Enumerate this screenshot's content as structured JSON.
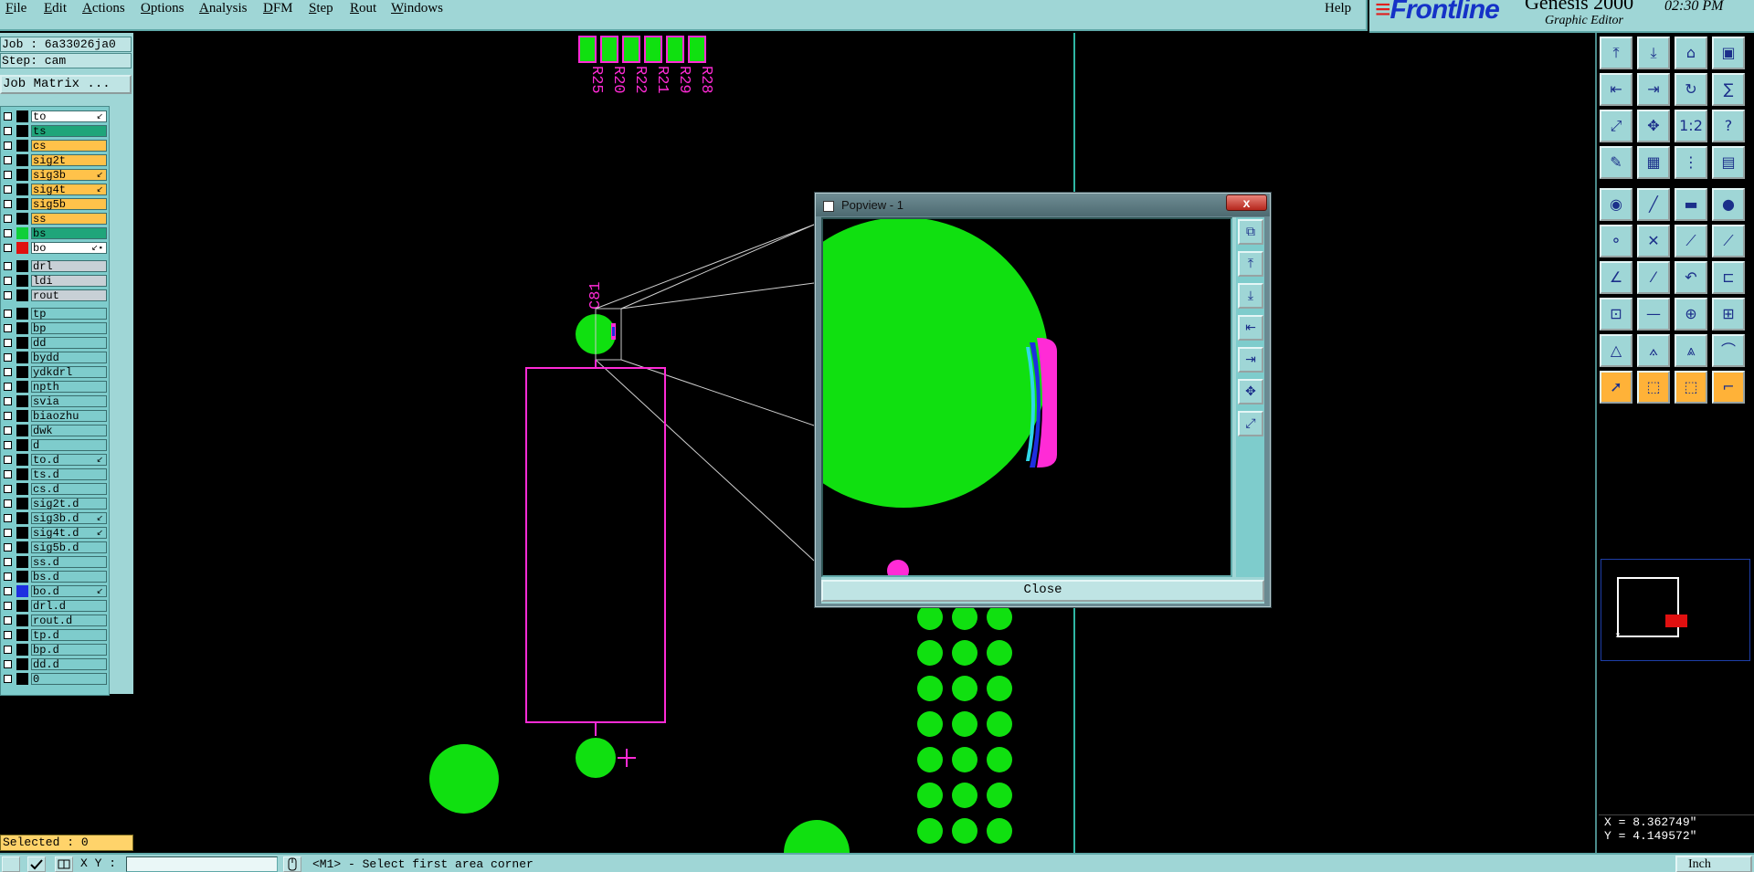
{
  "menu": {
    "items": [
      "File",
      "Edit",
      "Actions",
      "Options",
      "Analysis",
      "DFM",
      "Step",
      "Rout",
      "Windows"
    ],
    "help": "Help"
  },
  "brand": {
    "logo": "Frontline",
    "product": "Genesis 2000",
    "subtitle": "Graphic Editor",
    "time": "02:30 PM"
  },
  "job": {
    "job_line": "Job : 6a33026ja0",
    "step_line": "Step: cam",
    "matrix_button": "Job Matrix ..."
  },
  "layers": [
    {
      "name": "to",
      "swatch": "#000000",
      "bg": "#ffffff",
      "mark": "↙"
    },
    {
      "name": "ts",
      "swatch": "#000000",
      "bg": "#1fa57a",
      "mark": ""
    },
    {
      "name": "cs",
      "swatch": "#000000",
      "bg": "#ffc24a",
      "mark": ""
    },
    {
      "name": "sig2t",
      "swatch": "#000000",
      "bg": "#ffc24a",
      "mark": ""
    },
    {
      "name": "sig3b",
      "swatch": "#000000",
      "bg": "#ffc24a",
      "mark": "↙"
    },
    {
      "name": "sig4t",
      "swatch": "#000000",
      "bg": "#ffc24a",
      "mark": "↙"
    },
    {
      "name": "sig5b",
      "swatch": "#000000",
      "bg": "#ffc24a",
      "mark": ""
    },
    {
      "name": "ss",
      "swatch": "#000000",
      "bg": "#ffc24a",
      "mark": ""
    },
    {
      "name": "bs",
      "swatch": "#0fcf3a",
      "bg": "#1fa57a",
      "mark": ""
    },
    {
      "name": "bo",
      "swatch": "#e01010",
      "bg": "#ffffff",
      "mark": "↙▪"
    },
    {
      "name": "drl",
      "swatch": "#000000",
      "bg": "#c8d0d6",
      "mark": "",
      "gap": true
    },
    {
      "name": "ldi",
      "swatch": "#000000",
      "bg": "#c8d0d6",
      "mark": ""
    },
    {
      "name": "rout",
      "swatch": "#000000",
      "bg": "#c8d0d6",
      "mark": ""
    },
    {
      "name": "tp",
      "swatch": "#000000",
      "bg": "#7ecccc",
      "mark": "",
      "gap": true
    },
    {
      "name": "bp",
      "swatch": "#000000",
      "bg": "#7ecccc",
      "mark": ""
    },
    {
      "name": "dd",
      "swatch": "#000000",
      "bg": "#7ecccc",
      "mark": ""
    },
    {
      "name": "bydd",
      "swatch": "#000000",
      "bg": "#7ecccc",
      "mark": ""
    },
    {
      "name": "ydkdrl",
      "swatch": "#000000",
      "bg": "#7ecccc",
      "mark": ""
    },
    {
      "name": "npth",
      "swatch": "#000000",
      "bg": "#7ecccc",
      "mark": ""
    },
    {
      "name": "svia",
      "swatch": "#000000",
      "bg": "#7ecccc",
      "mark": ""
    },
    {
      "name": "biaozhu",
      "swatch": "#000000",
      "bg": "#7ecccc",
      "mark": ""
    },
    {
      "name": "dwk",
      "swatch": "#000000",
      "bg": "#7ecccc",
      "mark": ""
    },
    {
      "name": "d",
      "swatch": "#000000",
      "bg": "#7ecccc",
      "mark": ""
    },
    {
      "name": "to.d",
      "swatch": "#000000",
      "bg": "#7ecccc",
      "mark": "↙"
    },
    {
      "name": "ts.d",
      "swatch": "#000000",
      "bg": "#7ecccc",
      "mark": ""
    },
    {
      "name": "cs.d",
      "swatch": "#000000",
      "bg": "#7ecccc",
      "mark": ""
    },
    {
      "name": "sig2t.d",
      "swatch": "#000000",
      "bg": "#7ecccc",
      "mark": ""
    },
    {
      "name": "sig3b.d",
      "swatch": "#000000",
      "bg": "#7ecccc",
      "mark": "↙"
    },
    {
      "name": "sig4t.d",
      "swatch": "#000000",
      "bg": "#7ecccc",
      "mark": "↙"
    },
    {
      "name": "sig5b.d",
      "swatch": "#000000",
      "bg": "#7ecccc",
      "mark": ""
    },
    {
      "name": "ss.d",
      "swatch": "#000000",
      "bg": "#7ecccc",
      "mark": ""
    },
    {
      "name": "bs.d",
      "swatch": "#000000",
      "bg": "#7ecccc",
      "mark": ""
    },
    {
      "name": "bo.d",
      "swatch": "#1e2ee0",
      "bg": "#7ecccc",
      "mark": "↙"
    },
    {
      "name": "drl.d",
      "swatch": "#000000",
      "bg": "#7ecccc",
      "mark": ""
    },
    {
      "name": "rout.d",
      "swatch": "#000000",
      "bg": "#7ecccc",
      "mark": ""
    },
    {
      "name": "tp.d",
      "swatch": "#000000",
      "bg": "#7ecccc",
      "mark": ""
    },
    {
      "name": "bp.d",
      "swatch": "#000000",
      "bg": "#7ecccc",
      "mark": ""
    },
    {
      "name": "dd.d",
      "swatch": "#000000",
      "bg": "#7ecccc",
      "mark": ""
    },
    {
      "name": "0",
      "swatch": "#000000",
      "bg": "#7ecccc",
      "mark": ""
    }
  ],
  "selected": "Selected : 0",
  "canvas": {
    "refdes": [
      "R25",
      "R20",
      "R22",
      "R21",
      "R29",
      "R28"
    ],
    "cap_label": "C81"
  },
  "popview": {
    "title": "Popview - 1",
    "close_x": "x",
    "close_button": "Close"
  },
  "coords": {
    "x": "X = 8.362749\"",
    "y": "Y = 4.149572\""
  },
  "statusbar": {
    "xy_label": "X Y :",
    "message": "<M1> - Select first area corner",
    "unit": "Inch"
  },
  "colors": {
    "pad": "#10e010",
    "outline": "#ff2bd6",
    "panel": "#9fd6d6",
    "axis": "#2fb7a4"
  },
  "toolbar_icons": [
    "zoom-home-icon",
    "zoom-in-icon",
    "home-icon",
    "fit-window-icon",
    "pan-left-icon",
    "pan-right-icon",
    "redraw-icon",
    "snap-icon",
    "zoom-fit-icon",
    "pan-all-icon",
    "scale-1-2-icon",
    "help-icon",
    "measure-icon",
    "grid-icon",
    "layer-toggle-icon",
    "display-icon",
    "pad-icon",
    "line-icon",
    "ruler-icon",
    "circle-icon",
    "node-icon",
    "cross-icon",
    "connect-icon",
    "route-icon",
    "angle-icon",
    "slope-icon",
    "arc-icon",
    "feature-icon",
    "select-area-icon",
    "cut-line-icon",
    "drill-icon",
    "highlight-icon",
    "triangle-icon",
    "vertex-icon",
    "mountain-icon",
    "arch-icon",
    "pointer-icon",
    "select-box-icon",
    "select-net-icon",
    "corner-icon"
  ],
  "popview_icons": [
    "pv-zoom-icon",
    "pv-up-icon",
    "pv-down-icon",
    "pv-left-icon",
    "pv-right-icon",
    "pv-fit-icon",
    "pv-center-icon"
  ]
}
